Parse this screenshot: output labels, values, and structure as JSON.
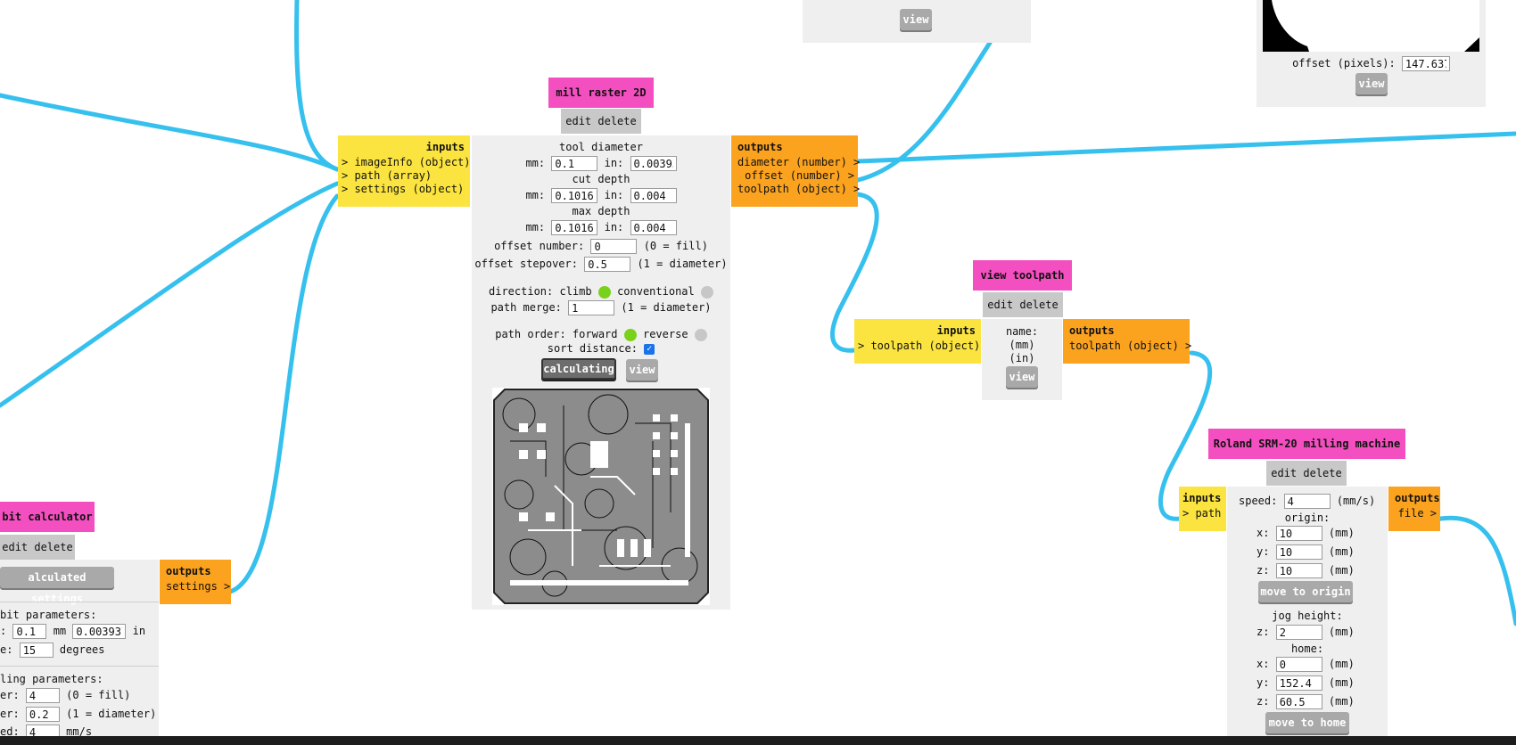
{
  "wire_color": "#36c0ee",
  "node_colors": {
    "title": "#f44fc0",
    "inputs": "#fbe43f",
    "outputs": "#fba21f",
    "panel": "#efefef"
  },
  "top_view_node": {
    "view_label": "view"
  },
  "image_node": {
    "offset_label": "offset (pixels):",
    "offset_value": "147.637",
    "view_label": "view"
  },
  "mill_raster": {
    "title": "mill raster 2D",
    "edit_delete": "edit delete",
    "inputs": {
      "header": "inputs",
      "ports": [
        "> imageInfo (object)",
        "> path (array)",
        "> settings (object)"
      ]
    },
    "outputs": {
      "header": "outputs",
      "ports": [
        "diameter (number) >",
        "offset (number) >",
        "toolpath (object) >"
      ]
    },
    "tool_diameter": {
      "label": "tool diameter",
      "mm_label": "mm:",
      "mm": "0.1",
      "in_label": "in:",
      "in": "0.00393"
    },
    "cut_depth": {
      "label": "cut depth",
      "mm_label": "mm:",
      "mm": "0.1016",
      "in_label": "in:",
      "in": "0.004"
    },
    "max_depth": {
      "label": "max depth",
      "mm_label": "mm:",
      "mm": "0.1016",
      "in_label": "in:",
      "in": "0.004"
    },
    "offset_number": {
      "label": "offset number:",
      "value": "0",
      "note": "(0 = fill)"
    },
    "offset_stepover": {
      "label": "offset stepover:",
      "value": "0.5",
      "note": "(1 = diameter)"
    },
    "direction": {
      "label": "direction: climb",
      "alt": "conventional",
      "selected": "climb"
    },
    "path_merge": {
      "label": "path merge:",
      "value": "1",
      "note": "(1 = diameter)"
    },
    "path_order": {
      "label": "path order: forward",
      "alt": "reverse",
      "selected": "forward"
    },
    "sort_distance": {
      "label": "sort distance:",
      "checked": true
    },
    "calculating_label": "calculating",
    "view_label": "view"
  },
  "view_toolpath": {
    "title": "view toolpath",
    "edit_delete": "edit delete",
    "inputs": {
      "header": "inputs",
      "ports": [
        "> toolpath (object)"
      ]
    },
    "outputs": {
      "header": "outputs",
      "ports": [
        "toolpath (object) >"
      ]
    },
    "name_label": "name:",
    "mm_label": "(mm)",
    "in_label": "(in)",
    "view_label": "view"
  },
  "roland": {
    "title": "Roland SRM-20 milling machine",
    "edit_delete": "edit delete",
    "inputs": {
      "header": "inputs",
      "ports": [
        "> path"
      ]
    },
    "outputs": {
      "header": "outputs",
      "ports": [
        "file >"
      ]
    },
    "speed_label": "speed:",
    "speed": "4",
    "speed_unit": "(mm/s)",
    "origin_label": "origin:",
    "origin": {
      "x": "10",
      "y": "10",
      "z": "10"
    },
    "unit_mm": "(mm)",
    "x_label": "x:",
    "y_label": "y:",
    "z_label": "z:",
    "move_origin": "move to origin",
    "jog_label": "jog height:",
    "jog_z": "2",
    "home_label": "home:",
    "home": {
      "x": "0",
      "y": "152.4",
      "z": "60.5"
    },
    "move_home": "move to home"
  },
  "bit_calculator": {
    "title": "bit calculator",
    "edit_delete": "edit delete",
    "calc_button": "alculated settings",
    "outputs": {
      "header": "outputs",
      "ports": [
        "settings >"
      ]
    },
    "bit_params": "bit parameters:",
    "diam_prefix": ":",
    "diam_mm": "0.1",
    "mm_unit": "mm",
    "diam_in": "0.0039370",
    "in_unit": "in",
    "angle_prefix": "e:",
    "angle": "15",
    "angle_unit": "degrees",
    "milling_params": "ling parameters:",
    "offset_prefix": "er:",
    "offset": "4",
    "offset_note": "(0 = fill)",
    "stepover_prefix": "er:",
    "stepover": "0.2",
    "stepover_note": "(1 = diameter)",
    "speed_prefix": "ed:",
    "speed": "4",
    "speed_unit": "mm/s"
  }
}
